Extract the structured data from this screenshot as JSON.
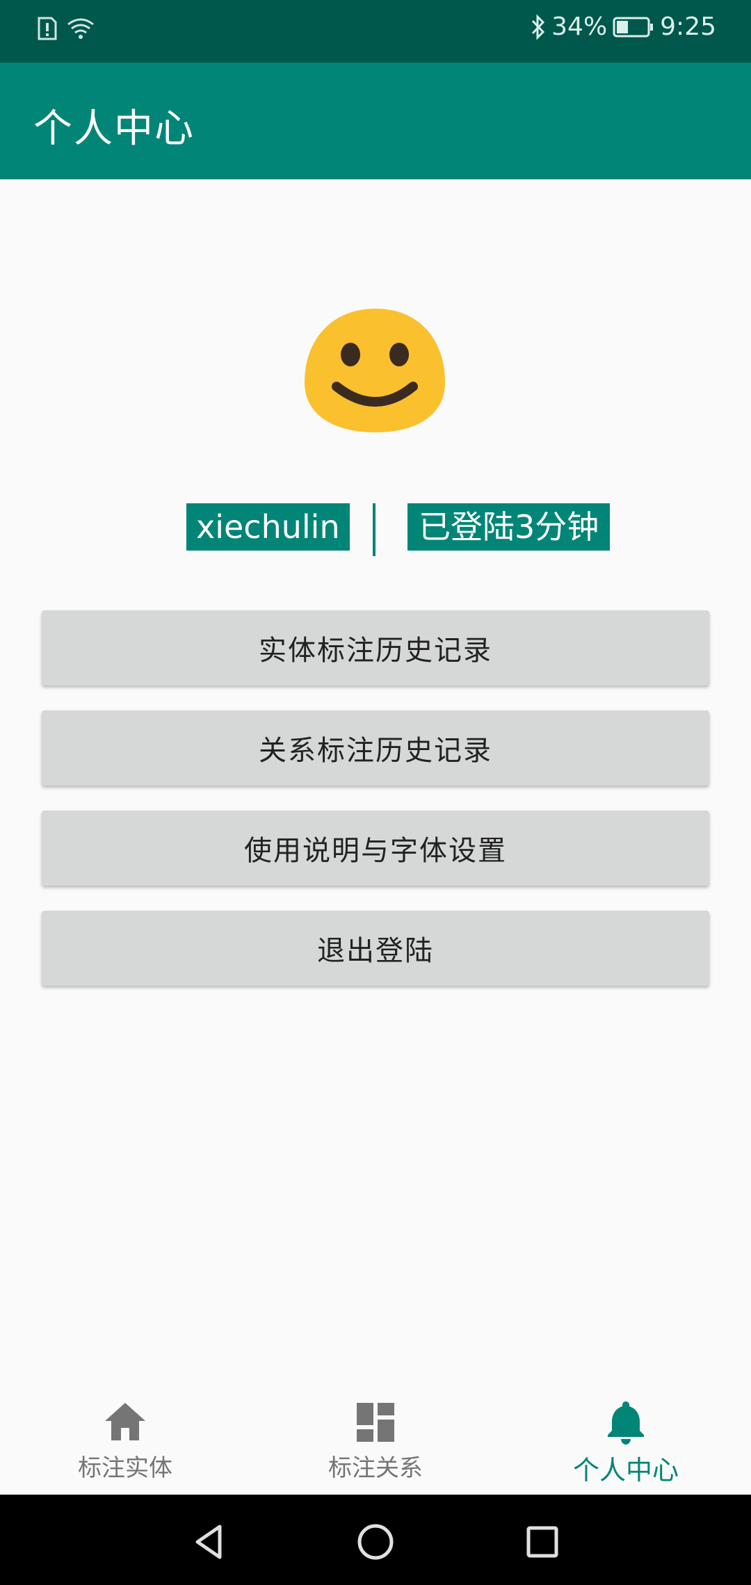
{
  "status_bar": {
    "battery": "34%",
    "time": "9:25"
  },
  "app_bar": {
    "title": "个人中心"
  },
  "profile": {
    "avatar_icon": "smiley-face-icon",
    "username": "xiechulin",
    "login_duration": "已登陆3分钟"
  },
  "menu": {
    "entity_history": "实体标注历史记录",
    "relation_history": "关系标注历史记录",
    "help_font_settings": "使用说明与字体设置",
    "logout": "退出登陆"
  },
  "bottom_nav": {
    "items": [
      {
        "label": "标注实体",
        "icon": "home-icon",
        "active": false
      },
      {
        "label": "标注关系",
        "icon": "dashboard-icon",
        "active": false
      },
      {
        "label": "个人中心",
        "icon": "bell-icon",
        "active": true
      }
    ]
  },
  "colors": {
    "primary": "#008577",
    "primary_dark": "#00574b",
    "button": "#d6d7d7",
    "avatar": "#fbc02d"
  }
}
